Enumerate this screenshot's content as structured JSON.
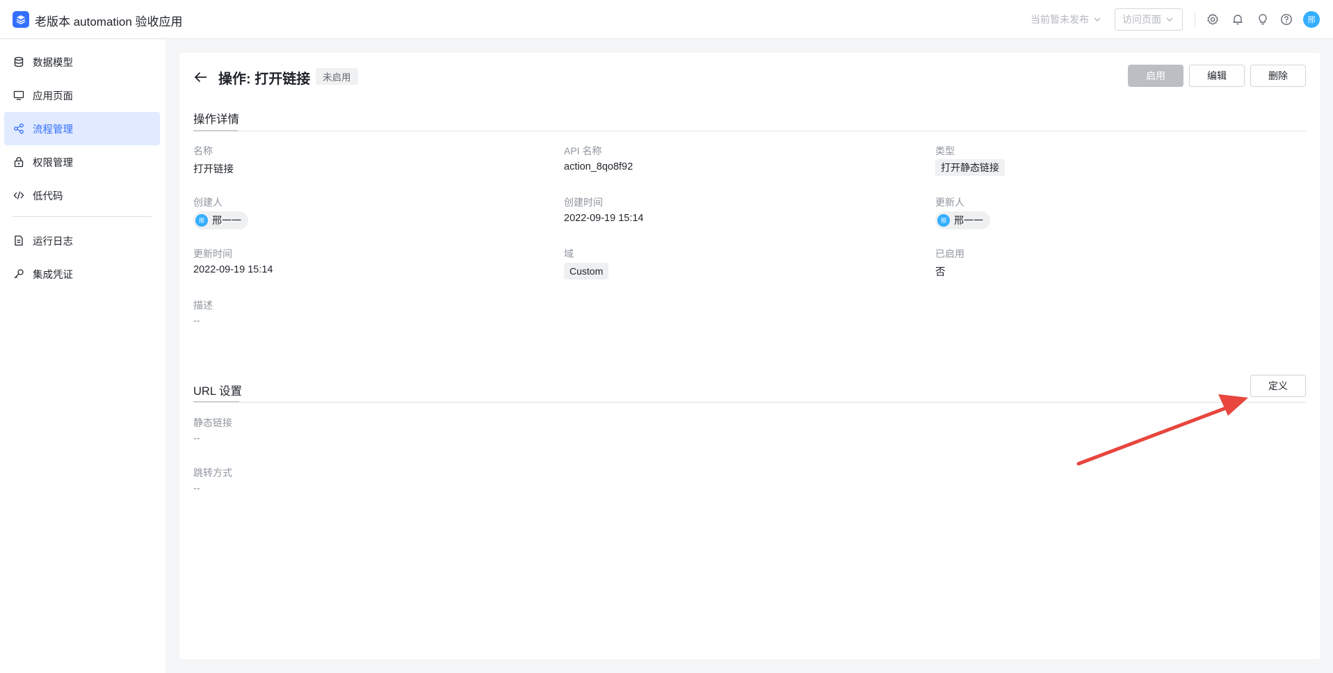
{
  "app": {
    "title": "老版本 automation 验收应用",
    "publish_status": "当前暂未发布",
    "visit_page": "访问页面",
    "avatar_text": "邢"
  },
  "sidebar": {
    "items": [
      {
        "label": "数据模型",
        "icon": "database-icon"
      },
      {
        "label": "应用页面",
        "icon": "monitor-icon"
      },
      {
        "label": "流程管理",
        "icon": "flow-icon",
        "active": true
      },
      {
        "label": "权限管理",
        "icon": "lock-icon"
      },
      {
        "label": "低代码",
        "icon": "code-icon"
      },
      {
        "label": "运行日志",
        "icon": "document-icon"
      },
      {
        "label": "集成凭证",
        "icon": "key-icon"
      }
    ]
  },
  "header": {
    "title": "操作: 打开链接",
    "status_tag": "未启用",
    "enable_label": "启用",
    "edit_label": "编辑",
    "delete_label": "删除"
  },
  "details": {
    "section_title": "操作详情",
    "name_label": "名称",
    "name_value": "打开链接",
    "api_label": "API 名称",
    "api_value": "action_8qo8f92",
    "type_label": "类型",
    "type_value": "打开静态链接",
    "creator_label": "创建人",
    "creator_value": "邢一一",
    "created_time_label": "创建时间",
    "created_time_value": "2022-09-19 15:14",
    "updater_label": "更新人",
    "updater_value": "邢一一",
    "updated_time_label": "更新时间",
    "updated_time_value": "2022-09-19 15:14",
    "domain_label": "域",
    "domain_value": "Custom",
    "enabled_label": "已启用",
    "enabled_value": "否",
    "description_label": "描述",
    "description_value": "--",
    "user_avatar_text": "邢"
  },
  "url_settings": {
    "section_title": "URL 设置",
    "define_label": "定义",
    "static_link_label": "静态链接",
    "static_link_value": "--",
    "redirect_label": "跳转方式",
    "redirect_value": "--"
  },
  "colors": {
    "accent": "#3370ff",
    "annotation_arrow": "#e8463e"
  }
}
